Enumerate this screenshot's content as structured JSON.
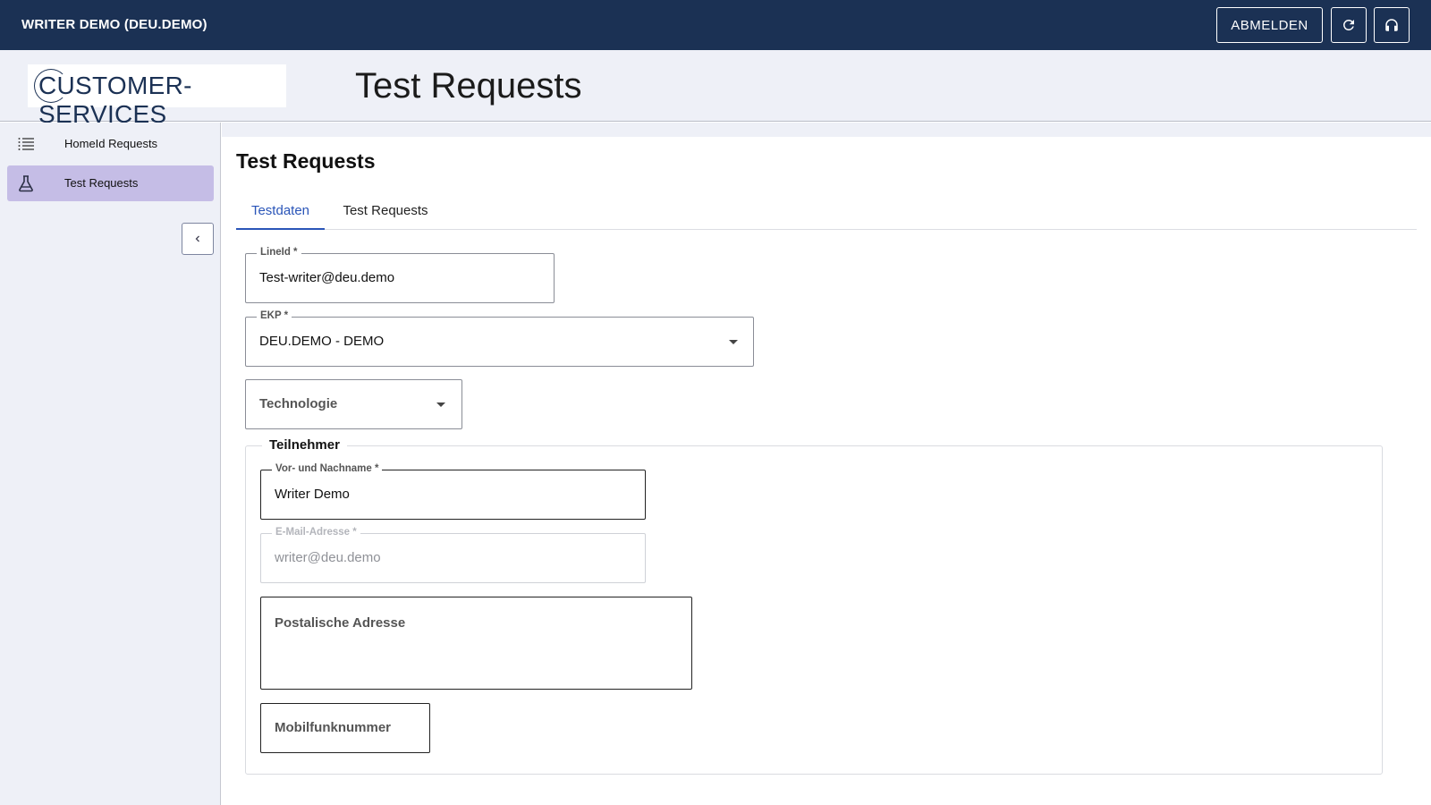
{
  "topbar": {
    "user_label": "WRITER DEMO (DEU.DEMO)",
    "logout_label": "ABMELDEN",
    "refresh_icon": "refresh-icon",
    "support_icon": "headset-icon"
  },
  "header": {
    "logo_text": "CUSTOMER-SERVICES",
    "title": "Test Requests"
  },
  "sidebar": {
    "items": [
      {
        "label": "HomeId Requests",
        "icon": "list-icon",
        "active": false
      },
      {
        "label": "Test Requests",
        "icon": "flask-icon",
        "active": true
      }
    ],
    "collapse_icon": "chevron-left-icon"
  },
  "main": {
    "title": "Test Requests",
    "tabs": [
      {
        "label": "Testdaten",
        "active": true
      },
      {
        "label": "Test Requests",
        "active": false
      }
    ],
    "form": {
      "line_id": {
        "label": "LineId *",
        "value": "Test-writer@deu.demo"
      },
      "ekp": {
        "label": "EKP *",
        "value": "DEU.DEMO - DEMO"
      },
      "technologie": {
        "placeholder": "Technologie"
      },
      "teilnehmer": {
        "legend": "Teilnehmer",
        "name": {
          "label": "Vor- und Nachname *",
          "value": "Writer Demo"
        },
        "email": {
          "label": "E-Mail-Adresse *",
          "value": "writer@deu.demo",
          "disabled": true
        },
        "address": {
          "placeholder": "Postalische Adresse"
        },
        "mobile": {
          "placeholder": "Mobilfunknummer"
        }
      }
    }
  },
  "colors": {
    "topbar": "#1b3154",
    "header_bg": "#eef0f7",
    "active_nav": "#c5bde6",
    "tab_accent": "#2a55b8"
  }
}
